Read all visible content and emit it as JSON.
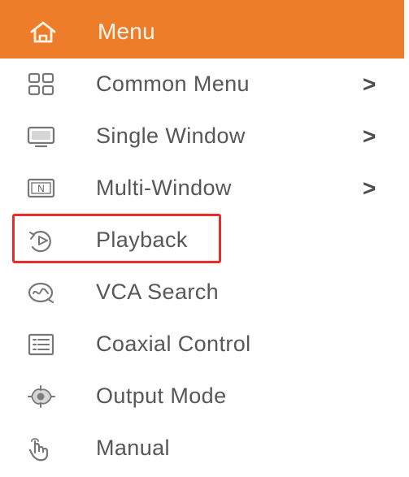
{
  "header": {
    "title": "Menu",
    "icon": "home-icon"
  },
  "items": [
    {
      "label": "Common Menu",
      "icon": "grid-icon",
      "chevron": ">"
    },
    {
      "label": "Single Window",
      "icon": "monitor-icon",
      "chevron": ">"
    },
    {
      "label": "Multi-Window",
      "icon": "multi-window-icon",
      "chevron": ">"
    },
    {
      "label": "Playback",
      "icon": "playback-icon"
    },
    {
      "label": "VCA Search",
      "icon": "vca-search-icon"
    },
    {
      "label": "Coaxial Control",
      "icon": "list-icon"
    },
    {
      "label": "Output Mode",
      "icon": "output-mode-icon"
    },
    {
      "label": "Manual",
      "icon": "hand-icon"
    }
  ],
  "highlighted_item": "Playback",
  "multi_window_icon_text": "N",
  "colors": {
    "header_bg": "#ee7d2a",
    "header_text": "#fff7ef",
    "item_text": "#575757",
    "highlight_border": "#e92b2c"
  }
}
